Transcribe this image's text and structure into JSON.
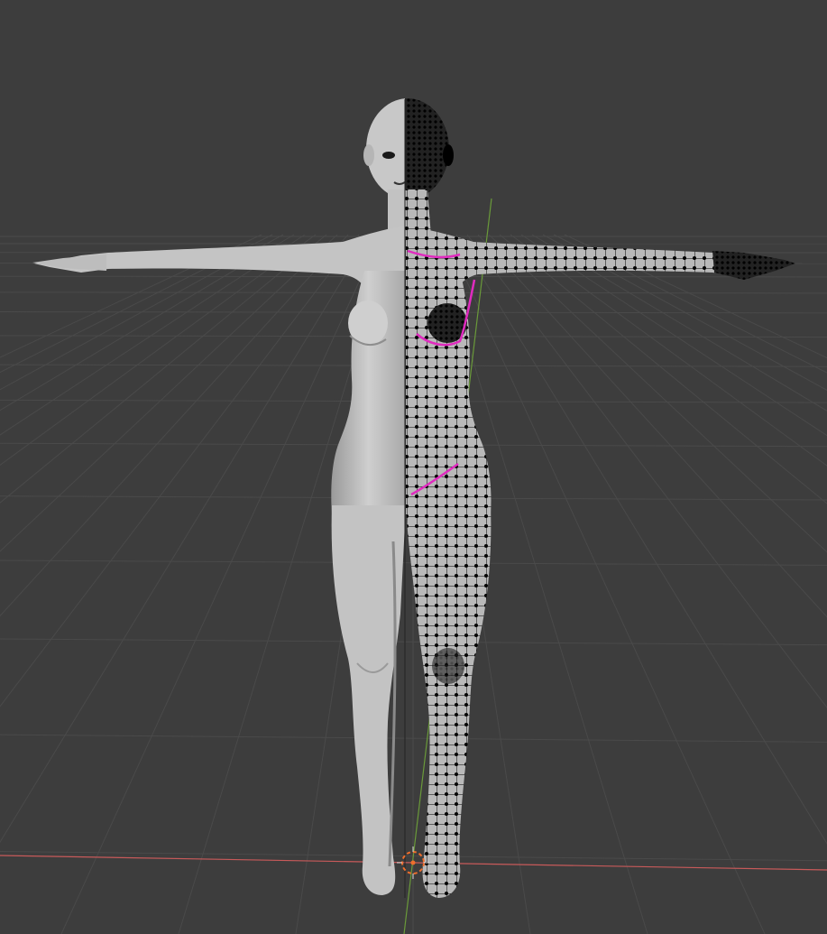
{
  "viewport": {
    "background": "#3d3d3d",
    "grid_color": "#4a4a4a",
    "x_axis_color": "#c85a5a",
    "y_axis_color": "#6a9a3a",
    "mesh_body_color": "#b9b9b9",
    "mesh_wire_color": "#000000",
    "seam_color": "#e02bbf",
    "cursor_color": "#ee6e2c"
  },
  "scene": {
    "object": "humanoid-mesh",
    "left_half_mode": "solid",
    "right_half_mode": "edit-wireframe",
    "icons": {
      "cursor": "3d-cursor-icon",
      "origin": "origin-icon"
    }
  }
}
